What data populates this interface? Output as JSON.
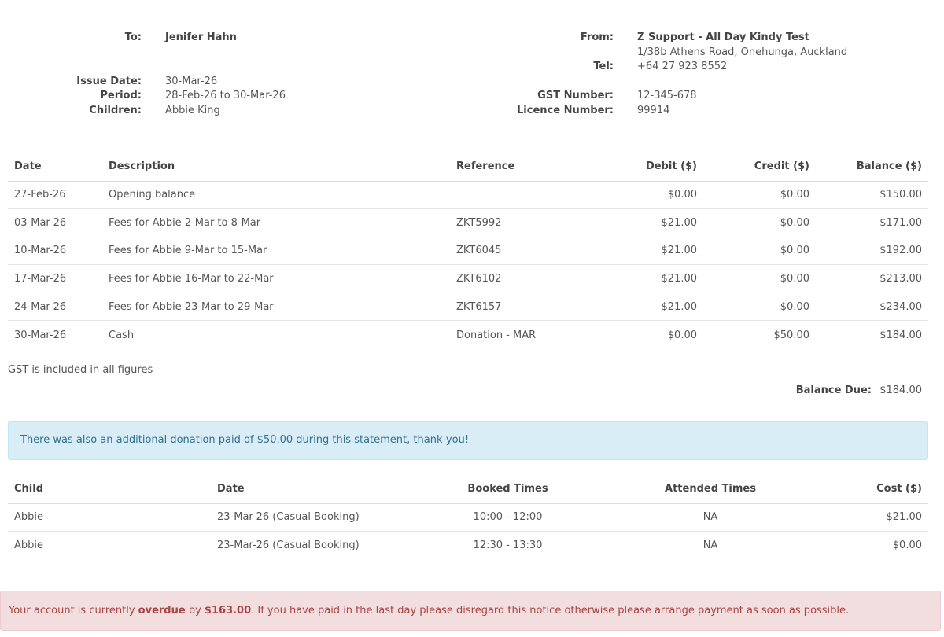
{
  "header": {
    "to_label": "To:",
    "to_name": "Jenifer Hahn",
    "issue_date_label": "Issue Date:",
    "issue_date": "30-Mar-26",
    "period_label": "Period:",
    "period": "28-Feb-26 to 30-Mar-26",
    "children_label": "Children:",
    "children": "Abbie King",
    "from_label": "From:",
    "from_name": "Z Support - All Day Kindy Test",
    "from_address": "1/38b Athens Road, Onehunga, Auckland",
    "tel_label": "Tel:",
    "tel": "+64 27 923 8552",
    "gst_label": "GST Number:",
    "gst": "12-345-678",
    "licence_label": "Licence Number:",
    "licence": "99914"
  },
  "transactions": {
    "headers": {
      "date": "Date",
      "description": "Description",
      "reference": "Reference",
      "debit": "Debit ($)",
      "credit": "Credit ($)",
      "balance": "Balance ($)"
    },
    "rows": [
      {
        "date": "27-Feb-26",
        "description": "Opening balance",
        "reference": "",
        "debit": "$0.00",
        "credit": "$0.00",
        "balance": "$150.00"
      },
      {
        "date": "03-Mar-26",
        "description": "Fees for Abbie 2-Mar to 8-Mar",
        "reference": "ZKT5992",
        "debit": "$21.00",
        "credit": "$0.00",
        "balance": "$171.00"
      },
      {
        "date": "10-Mar-26",
        "description": "Fees for Abbie 9-Mar to 15-Mar",
        "reference": "ZKT6045",
        "debit": "$21.00",
        "credit": "$0.00",
        "balance": "$192.00"
      },
      {
        "date": "17-Mar-26",
        "description": "Fees for Abbie 16-Mar to 22-Mar",
        "reference": "ZKT6102",
        "debit": "$21.00",
        "credit": "$0.00",
        "balance": "$213.00"
      },
      {
        "date": "24-Mar-26",
        "description": "Fees for Abbie 23-Mar to 29-Mar",
        "reference": "ZKT6157",
        "debit": "$21.00",
        "credit": "$0.00",
        "balance": "$234.00"
      },
      {
        "date": "30-Mar-26",
        "description": "Cash",
        "reference": "Donation - MAR",
        "debit": "$0.00",
        "credit": "$50.00",
        "balance": "$184.00"
      }
    ]
  },
  "gst_note": "GST is included in all figures",
  "balance_due": {
    "label": "Balance Due:",
    "value": "$184.00"
  },
  "donation_notice": "There was also an additional donation paid of $50.00 during this statement, thank-you!",
  "bookings": {
    "headers": {
      "child": "Child",
      "date": "Date",
      "booked": "Booked Times",
      "attended": "Attended Times",
      "cost": "Cost ($)"
    },
    "rows": [
      {
        "child": "Abbie",
        "date": "23-Mar-26 (Casual Booking)",
        "booked": "10:00 - 12:00",
        "attended": "NA",
        "cost": "$21.00"
      },
      {
        "child": "Abbie",
        "date": "23-Mar-26 (Casual Booking)",
        "booked": "12:30 - 13:30",
        "attended": "NA",
        "cost": "$0.00"
      }
    ]
  },
  "overdue_notice": {
    "prefix": "Your account is currently ",
    "status": "overdue",
    "middle": " by ",
    "amount": "$163.00",
    "suffix": ". If you have paid in the last day please disregard this notice otherwise please arrange payment as soon as possible."
  }
}
